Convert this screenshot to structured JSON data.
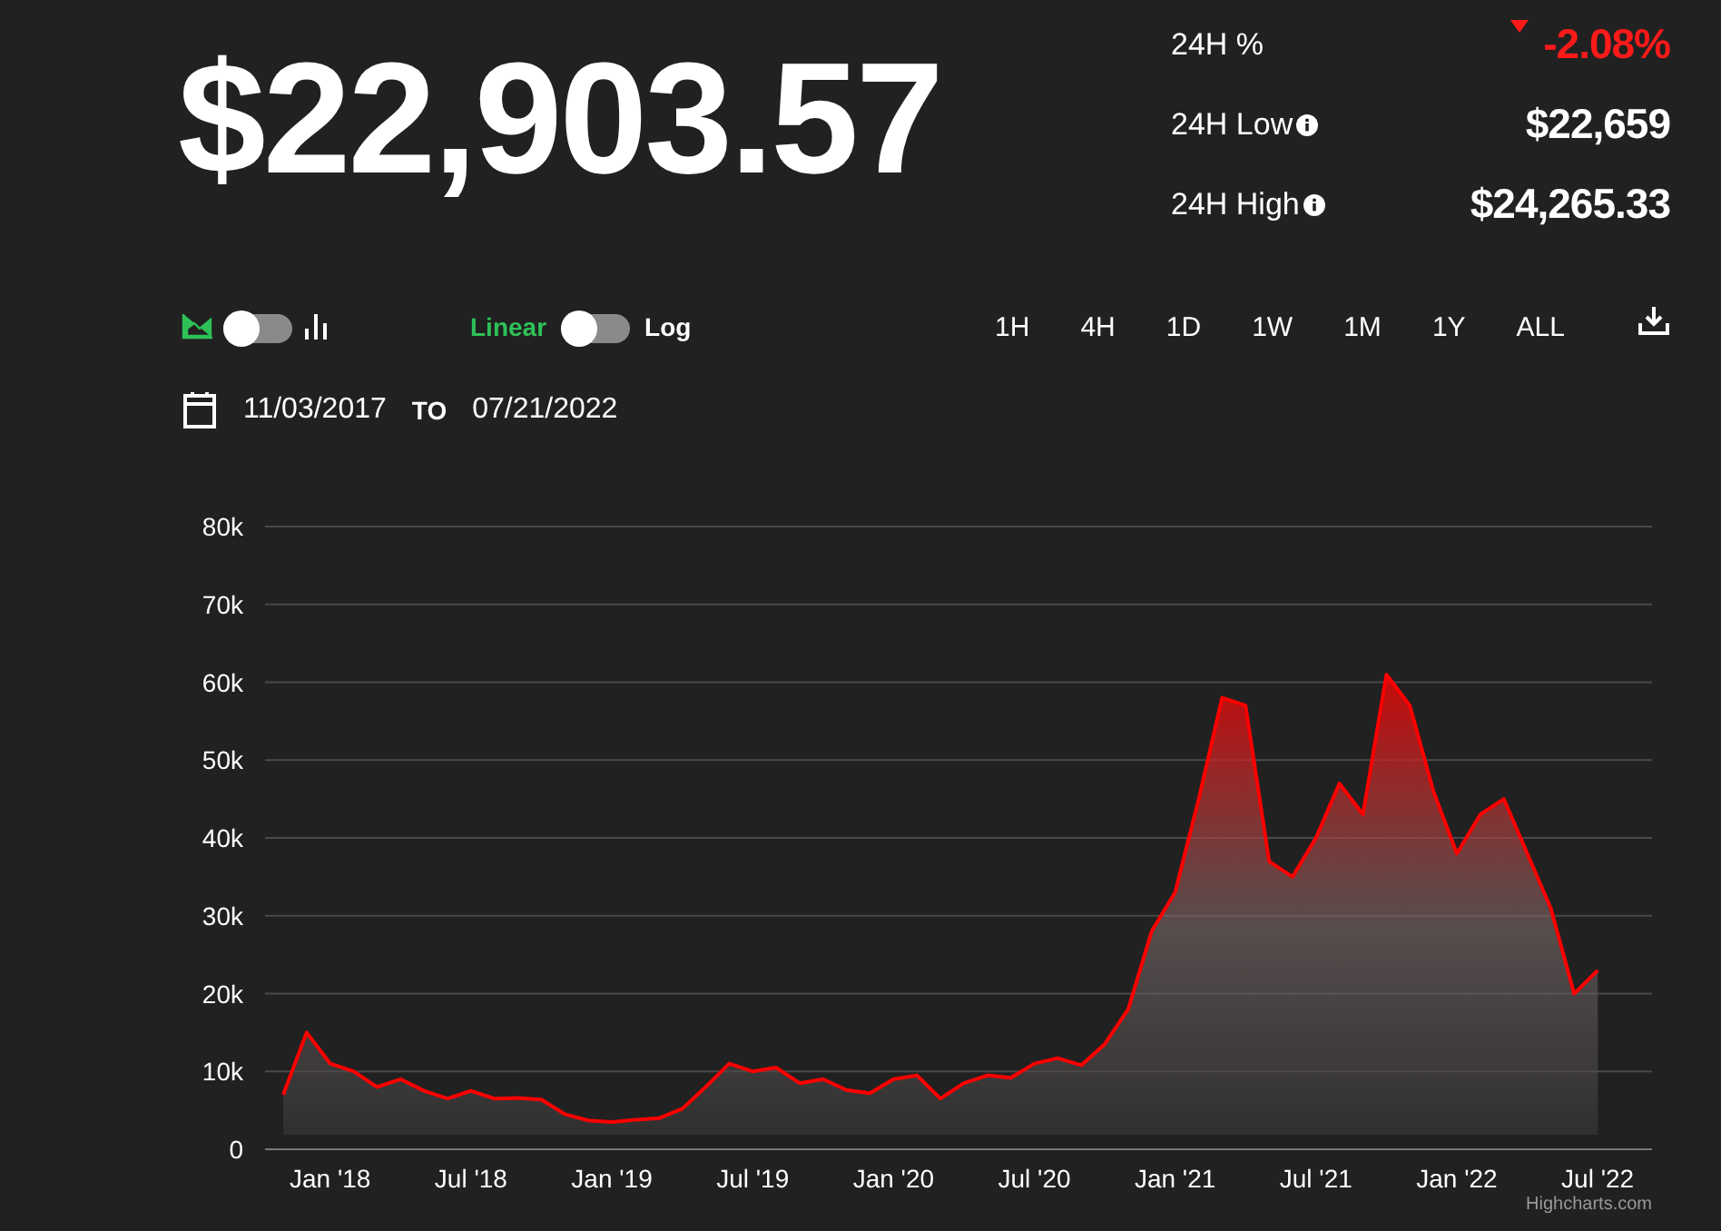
{
  "price": "$22,903.57",
  "stats": [
    {
      "label": "24H %",
      "value": "-2.08%",
      "kind": "change_down",
      "info": false
    },
    {
      "label": "24H Low",
      "value": "$22,659",
      "kind": "price",
      "info": true
    },
    {
      "label": "24H High",
      "value": "$24,265.33",
      "kind": "price",
      "info": true
    }
  ],
  "chart_type_toggle": {
    "on": false
  },
  "scale_toggle": {
    "off_label": "Linear",
    "on_label": "Log",
    "on": false
  },
  "ranges": [
    {
      "label": "1H",
      "selected": false
    },
    {
      "label": "4H",
      "selected": false
    },
    {
      "label": "1D",
      "selected": false
    },
    {
      "label": "1W",
      "selected": false
    },
    {
      "label": "1M",
      "selected": false
    },
    {
      "label": "1Y",
      "selected": false
    },
    {
      "label": "ALL",
      "selected": false
    }
  ],
  "date_range": {
    "from": "11/03/2017",
    "separator": "TO",
    "to": "07/21/2022"
  },
  "chart": {
    "credits": "Highcharts.com",
    "chart_data": {
      "type": "area",
      "categories": [
        null,
        null,
        "Jan '18",
        null,
        null,
        null,
        null,
        null,
        "Jul '18",
        null,
        null,
        null,
        null,
        null,
        "Jan '19",
        null,
        null,
        null,
        null,
        null,
        "Jul '19",
        null,
        null,
        null,
        null,
        null,
        "Jan '20",
        null,
        null,
        null,
        null,
        null,
        "Jul '20",
        null,
        null,
        null,
        null,
        null,
        "Jan '21",
        null,
        null,
        null,
        null,
        null,
        "Jul '21",
        null,
        null,
        null,
        null,
        null,
        "Jan '22",
        null,
        null,
        null,
        null,
        null,
        "Jul '22"
      ],
      "series": [
        {
          "color": "#ff0000",
          "values": [
            7000,
            15000,
            11000,
            10000,
            8000,
            9000,
            7500,
            6500,
            7500,
            6500,
            6600,
            6400,
            4500,
            3700,
            3500,
            3800,
            4000,
            5200,
            8000,
            11000,
            10000,
            10500,
            8500,
            9000,
            7600,
            7200,
            9000,
            9500,
            6500,
            8500,
            9500,
            9200,
            11000,
            11700,
            10800,
            13500,
            18000,
            28000,
            33000,
            45000,
            58000,
            57000,
            37000,
            35000,
            40000,
            47000,
            43000,
            61000,
            57000,
            46000,
            38000,
            43000,
            45000,
            38000,
            31000,
            20000,
            23000
          ]
        }
      ],
      "ylim": [
        0,
        80000
      ],
      "grid": true,
      "yticks": [
        {
          "value": 0,
          "label": "0"
        },
        {
          "value": 10000,
          "label": "10k"
        },
        {
          "value": 20000,
          "label": "20k"
        },
        {
          "value": 30000,
          "label": "30k"
        },
        {
          "value": 40000,
          "label": "40k"
        },
        {
          "value": 50000,
          "label": "50k"
        },
        {
          "value": 60000,
          "label": "60k"
        },
        {
          "value": 70000,
          "label": "70k"
        },
        {
          "value": 80000,
          "label": "80k"
        }
      ]
    }
  }
}
